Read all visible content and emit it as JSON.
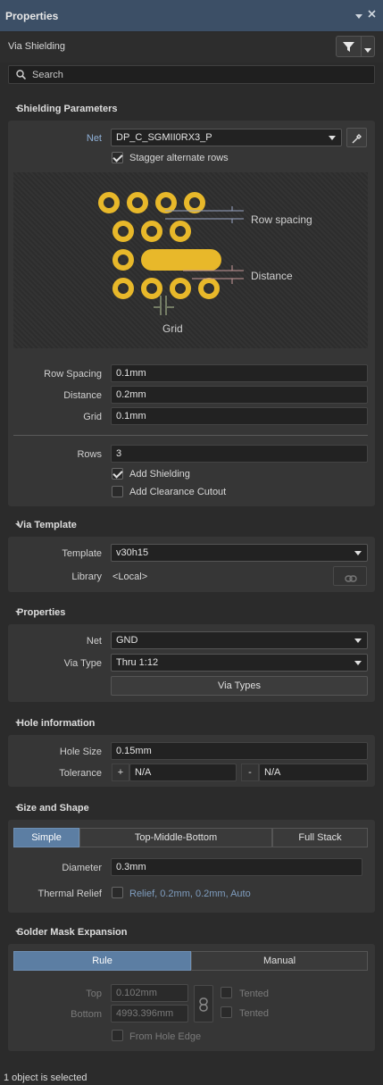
{
  "window": {
    "title": "Properties",
    "pin_icon": "pin-icon",
    "close_icon": "close-icon"
  },
  "header": {
    "object_type": "Via Shielding",
    "search_placeholder": "Search"
  },
  "shielding": {
    "title": "Shielding Parameters",
    "net_label": "Net",
    "net_value": "DP_C_SGMII0RX3_P",
    "stagger_label": "Stagger alternate rows",
    "stagger_checked": true,
    "diagram": {
      "row_spacing": "Row spacing",
      "distance": "Distance",
      "grid": "Grid"
    },
    "row_spacing_label": "Row Spacing",
    "row_spacing_value": "0.1mm",
    "distance_label": "Distance",
    "distance_value": "0.2mm",
    "grid_label": "Grid",
    "grid_value": "0.1mm",
    "rows_label": "Rows",
    "rows_value": "3",
    "add_shielding_label": "Add Shielding",
    "add_shielding_checked": true,
    "add_clearance_label": "Add Clearance Cutout",
    "add_clearance_checked": false
  },
  "via_template": {
    "title": "Via Template",
    "template_label": "Template",
    "template_value": "v30h15",
    "library_label": "Library",
    "library_value": "<Local>"
  },
  "properties": {
    "title": "Properties",
    "net_label": "Net",
    "net_value": "GND",
    "via_type_label": "Via Type",
    "via_type_value": "Thru 1:12",
    "via_types_button": "Via Types"
  },
  "hole": {
    "title": "Hole information",
    "size_label": "Hole Size",
    "size_value": "0.15mm",
    "tolerance_label": "Tolerance",
    "plus": "+",
    "minus": "-",
    "tol_plus": "N/A",
    "tol_minus": "N/A"
  },
  "size_shape": {
    "title": "Size and Shape",
    "tabs": [
      "Simple",
      "Top-Middle-Bottom",
      "Full Stack"
    ],
    "selected_tab": "Simple",
    "diameter_label": "Diameter",
    "diameter_value": "0.3mm",
    "thermal_label": "Thermal Relief",
    "thermal_value": "Relief, 0.2mm, 0.2mm, Auto"
  },
  "solder_mask": {
    "title": "Solder Mask Expansion",
    "tabs": [
      "Rule",
      "Manual"
    ],
    "selected_tab": "Rule",
    "top_label": "Top",
    "top_value": "0.102mm",
    "bottom_label": "Bottom",
    "bottom_value": "4993.396mm",
    "tented_top": "Tented",
    "tented_bottom": "Tented",
    "from_hole_edge": "From Hole Edge"
  },
  "status": {
    "text": "1 object is selected"
  },
  "colors": {
    "accent": "#5c7ea3",
    "via": "#e8b82a",
    "title_bar": "#3c4f66",
    "link_text": "#7f9dbf"
  }
}
